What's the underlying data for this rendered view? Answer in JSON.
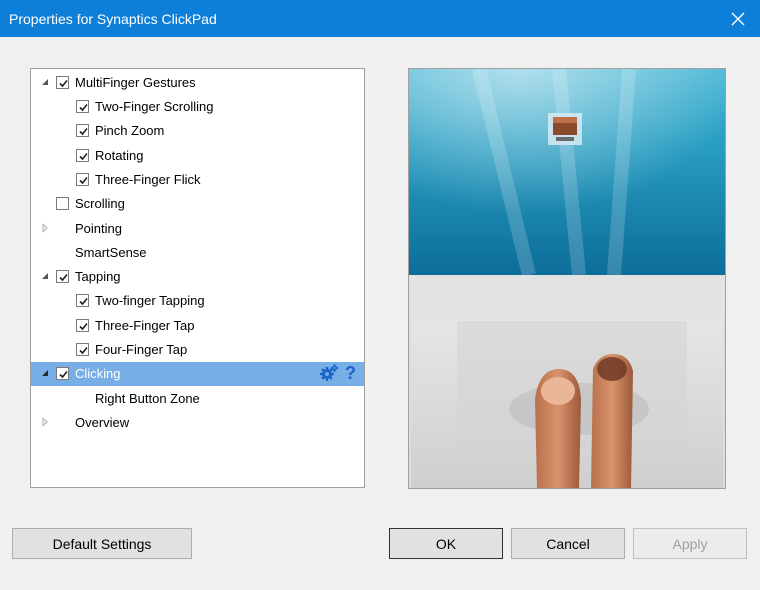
{
  "window": {
    "title": "Properties for Synaptics ClickPad",
    "close_icon": "close-icon"
  },
  "tree": {
    "items": [
      {
        "label": "MultiFinger Gestures",
        "checked": true,
        "level": 0,
        "expander": "expanded"
      },
      {
        "label": "Two-Finger Scrolling",
        "checked": true,
        "level": 1
      },
      {
        "label": "Pinch Zoom",
        "checked": true,
        "level": 1
      },
      {
        "label": "Rotating",
        "checked": true,
        "level": 1
      },
      {
        "label": "Three-Finger Flick",
        "checked": true,
        "level": 1
      },
      {
        "label": "Scrolling",
        "checked": false,
        "level": 0
      },
      {
        "label": "Pointing",
        "level": 0,
        "expander": "collapsed"
      },
      {
        "label": "SmartSense",
        "level": 0
      },
      {
        "label": "Tapping",
        "checked": true,
        "level": 0,
        "expander": "expanded"
      },
      {
        "label": "Two-finger Tapping",
        "checked": true,
        "level": 1
      },
      {
        "label": "Three-Finger Tap",
        "checked": true,
        "level": 1
      },
      {
        "label": "Four-Finger Tap",
        "checked": true,
        "level": 1
      },
      {
        "label": "Clicking",
        "checked": true,
        "level": 0,
        "expander": "expanded",
        "selected": true
      },
      {
        "label": "Right Button Zone",
        "level": 1
      },
      {
        "label": "Overview",
        "level": 0,
        "expander": "collapsed"
      }
    ],
    "selected_tools": {
      "settings_icon": "gear-icon",
      "help_label": "?"
    }
  },
  "buttons": {
    "default_settings": "Default Settings",
    "ok": "OK",
    "cancel": "Cancel",
    "apply": "Apply"
  },
  "colors": {
    "titlebar": "#0e7fd9",
    "selection": "#78aee6",
    "help": "#1a64c8"
  }
}
